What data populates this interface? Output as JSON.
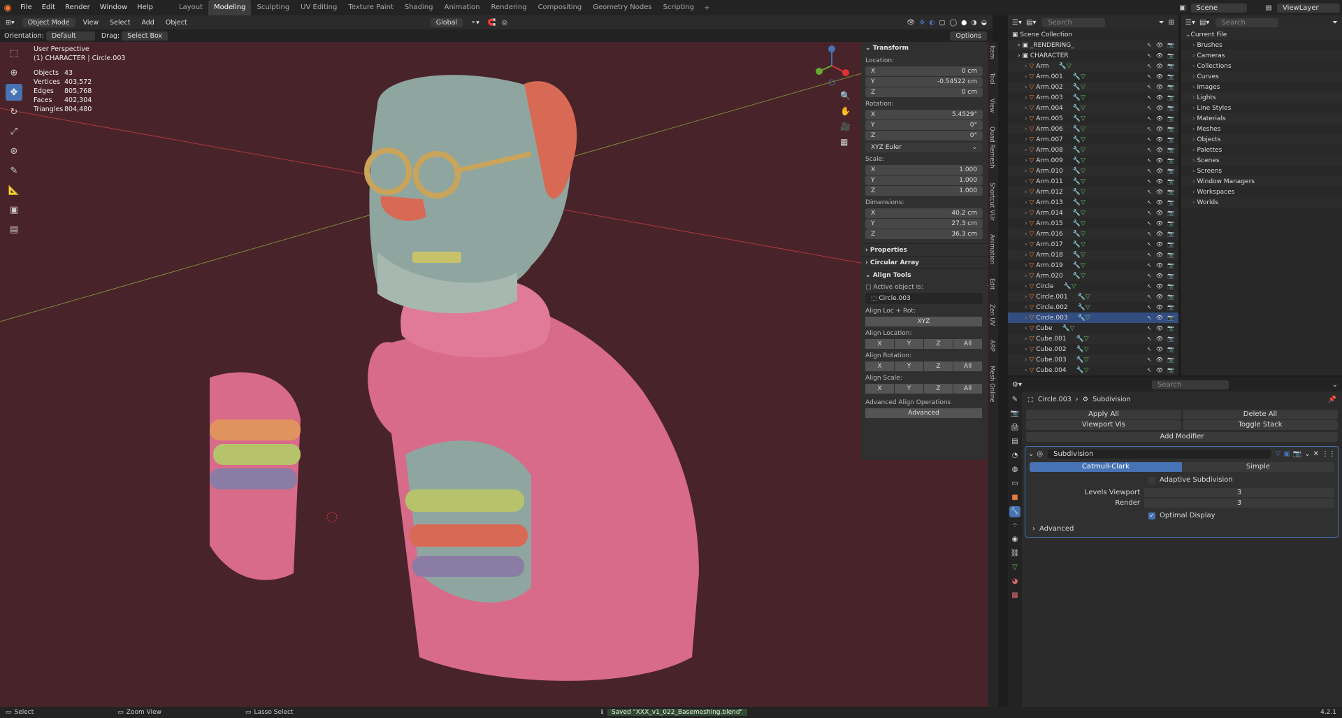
{
  "topbar": {
    "menus": [
      "File",
      "Edit",
      "Render",
      "Window",
      "Help"
    ],
    "workspaces": [
      "Layout",
      "Modeling",
      "Sculpting",
      "UV Editing",
      "Texture Paint",
      "Shading",
      "Animation",
      "Rendering",
      "Compositing",
      "Geometry Nodes",
      "Scripting"
    ],
    "active_workspace": "Modeling",
    "scene": "Scene",
    "viewlayer": "ViewLayer"
  },
  "viewport_header": {
    "mode": "Object Mode",
    "menus": [
      "View",
      "Select",
      "Add",
      "Object"
    ],
    "transform": "Global",
    "orientation_label": "Orientation:",
    "orientation_value": "Default",
    "drag_label": "Drag:",
    "drag_value": "Select Box",
    "options": "Options"
  },
  "overlay": {
    "perspective": "User Perspective",
    "object": "(1) CHARACTER | Circle.003",
    "stats": [
      {
        "label": "Objects",
        "value": "43"
      },
      {
        "label": "Vertices",
        "value": "403,572"
      },
      {
        "label": "Edges",
        "value": "805,768"
      },
      {
        "label": "Faces",
        "value": "402,304"
      },
      {
        "label": "Triangles",
        "value": "804,480"
      }
    ]
  },
  "npanel": {
    "transform_title": "Transform",
    "location_label": "Location:",
    "location": [
      {
        "axis": "X",
        "value": "0 cm"
      },
      {
        "axis": "Y",
        "value": "-0.54522 cm"
      },
      {
        "axis": "Z",
        "value": "0 cm"
      }
    ],
    "rotation_label": "Rotation:",
    "rotation": [
      {
        "axis": "X",
        "value": "5.4529°"
      },
      {
        "axis": "Y",
        "value": "0°"
      },
      {
        "axis": "Z",
        "value": "0°"
      }
    ],
    "rotation_mode": "XYZ Euler",
    "scale_label": "Scale:",
    "scale": [
      {
        "axis": "X",
        "value": "1.000"
      },
      {
        "axis": "Y",
        "value": "1.000"
      },
      {
        "axis": "Z",
        "value": "1.000"
      }
    ],
    "dimensions_label": "Dimensions:",
    "dimensions": [
      {
        "axis": "X",
        "value": "40.2 cm"
      },
      {
        "axis": "Y",
        "value": "27.3 cm"
      },
      {
        "axis": "Z",
        "value": "36.3 cm"
      }
    ],
    "properties_title": "Properties",
    "circular_array_title": "Circular Array",
    "align_tools_title": "Align Tools",
    "active_object_is": "Active object is:",
    "active_object": "Circle.003",
    "align_locrot_label": "Align Loc + Rot:",
    "align_locrot_btn": "XYZ",
    "align_location_label": "Align Location:",
    "align_rotation_label": "Align Rotation:",
    "align_scale_label": "Align Scale:",
    "axis_buttons": [
      "X",
      "Y",
      "Z",
      "All"
    ],
    "advanced_ops_label": "Advanced Align Operations",
    "advanced_btn": "Advanced"
  },
  "side_tabs": [
    "Item",
    "Tool",
    "View",
    "Quad Remesh",
    "Shortcut VUr",
    "Animation",
    "Edit",
    "Zen UV",
    "ARP",
    "Mesh Online"
  ],
  "outliner": {
    "search_placeholder": "Search",
    "root": "Scene Collection",
    "collections": [
      "_RENDERING_",
      "CHARACTER"
    ],
    "objects": [
      "Arm",
      "Arm.001",
      "Arm.002",
      "Arm.003",
      "Arm.004",
      "Arm.005",
      "Arm.006",
      "Arm.007",
      "Arm.008",
      "Arm.009",
      "Arm.010",
      "Arm.011",
      "Arm.012",
      "Arm.013",
      "Arm.014",
      "Arm.015",
      "Arm.016",
      "Arm.017",
      "Arm.018",
      "Arm.019",
      "Arm.020",
      "Circle",
      "Circle.001",
      "Circle.002",
      "Circle.003",
      "Cube",
      "Cube.001",
      "Cube.002",
      "Cube.003",
      "Cube.004"
    ]
  },
  "blendfile": {
    "search_placeholder": "Search",
    "root": "Current File",
    "items": [
      "Brushes",
      "Cameras",
      "Collections",
      "Curves",
      "Images",
      "Lights",
      "Line Styles",
      "Materials",
      "Meshes",
      "Objects",
      "Palettes",
      "Scenes",
      "Screens",
      "Window Managers",
      "Workspaces",
      "Worlds"
    ]
  },
  "properties": {
    "search_placeholder": "Search",
    "breadcrumb_object": "Circle.003",
    "breadcrumb_modifier": "Subdivision",
    "apply_all": "Apply All",
    "delete_all": "Delete All",
    "viewport_vis": "Viewport Vis",
    "toggle_stack": "Toggle Stack",
    "add_modifier": "Add Modifier",
    "modifier_name": "Subdivision",
    "mode_catmull": "Catmull-Clark",
    "mode_simple": "Simple",
    "adaptive": "Adaptive Subdivision",
    "levels_viewport_label": "Levels Viewport",
    "levels_viewport": "3",
    "render_label": "Render",
    "render_value": "3",
    "optimal_display": "Optimal Display",
    "advanced": "Advanced"
  },
  "statusbar": {
    "select": "Select",
    "zoom": "Zoom View",
    "lasso": "Lasso Select",
    "saved": "Saved \"XXX_v1_022_Basemeshing.blend\"",
    "version": "4.2.1"
  },
  "colors": {
    "viewport_bg": "#48232a",
    "accent": "#4772b3",
    "skin": "#d86a8a"
  }
}
